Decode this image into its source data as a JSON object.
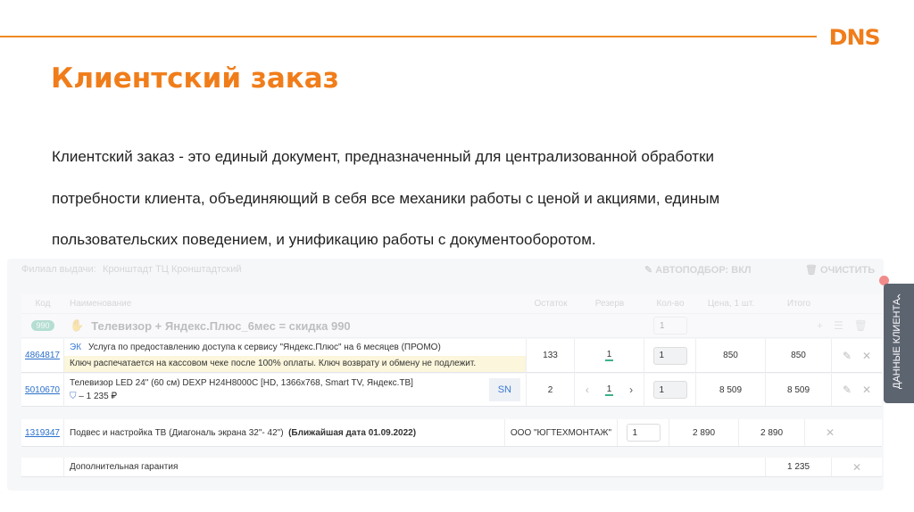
{
  "logo": "DNS",
  "title": "Клиентский заказ",
  "paragraph": [
    "Клиентский заказ - это единый документ, предназначенный для централизованной обработки",
    "потребности клиента, объединяющий в себя все механики работы с ценой и акциями, единым",
    "пользовательских поведением, и унификацию работы с документооборотом."
  ],
  "toolbar": {
    "branch_label": "Филиал выдачи:",
    "branch_value": "Кронштадт ТЦ Кронштадтский",
    "autoselect": "АВТОПОДБОР: ВКЛ",
    "clear": "ОЧИСТИТЬ"
  },
  "columns": [
    "Код",
    "Наименование",
    "Остаток",
    "Резерв",
    "Кол-во",
    "Цена, 1 шт.",
    "Итого"
  ],
  "group": {
    "badge": "990",
    "name": "Телевизор + Яндекс.Плюс_6мес = скидка 990",
    "qty": "1"
  },
  "rows": [
    {
      "code": "4864817",
      "tag": "ЭК",
      "name": "Услуга по предоставлению доступа к сервису \"Яндекс.Плюс\" на 6 месяцев (ПРОМО)",
      "note": "Ключ распечатается на кассовом чеке после 100% оплаты. Ключ возврату и обмену не подлежит.",
      "stock": "133",
      "reserve": "1",
      "qty": "1",
      "price": "850",
      "total": "850"
    },
    {
      "code": "5010670",
      "name": "Телевизор LED 24\" (60 см) DEXP H24H8000C [HD, 1366x768, Smart TV, Яндекс.ТВ]",
      "warranty": "– 1 235 ₽",
      "sn": "SN",
      "stock": "2",
      "reserve": "1",
      "qty": "1",
      "price": "8 509",
      "total": "8 509"
    },
    {
      "code": "1319347",
      "name": "Подвес и настройка ТВ (Диагональ экрана 32\"- 42\")",
      "date": "(Ближайшая дата 01.09.2022)",
      "supplier": "ООО \"ЮГТЕХМОНТАЖ\"",
      "qty": "1",
      "price": "2 890",
      "total": "2 890"
    },
    {
      "name": "Дополнительная гарантия",
      "total": "1 235"
    }
  ],
  "side_tab": "ДАННЫЕ КЛИЕНТА"
}
